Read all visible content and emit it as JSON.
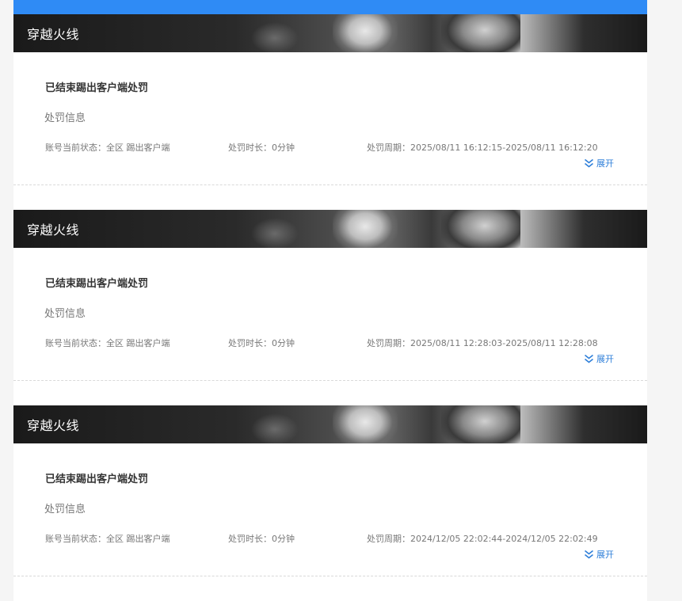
{
  "cards": [
    {
      "game": "穿越火线",
      "title": "已结束踢出客户端处罚",
      "info_label": "处罚信息",
      "status": "账号当前状态：全区 踢出客户端",
      "duration": "处罚时长：0分钟",
      "period": "处罚周期：2025/08/11 16:12:15-2025/08/11 16:12:20",
      "expand_label": "展开"
    },
    {
      "game": "穿越火线",
      "title": "已结束踢出客户端处罚",
      "info_label": "处罚信息",
      "status": "账号当前状态：全区 踢出客户端",
      "duration": "处罚时长：0分钟",
      "period": "处罚周期：2025/08/11 12:28:03-2025/08/11 12:28:08",
      "expand_label": "展开"
    },
    {
      "game": "穿越火线",
      "title": "已结束踢出客户端处罚",
      "info_label": "处罚信息",
      "status": "账号当前状态：全区 踢出客户端",
      "duration": "处罚时长：0分钟",
      "period": "处罚周期：2024/12/05 22:02:44-2024/12/05 22:02:49",
      "expand_label": "展开"
    }
  ],
  "colors": {
    "accent": "#2f8bf5",
    "link": "#2f7fd9",
    "banner_bg": "#1a1a1a"
  },
  "icons": {
    "expand": "double-chevron-down-icon"
  }
}
